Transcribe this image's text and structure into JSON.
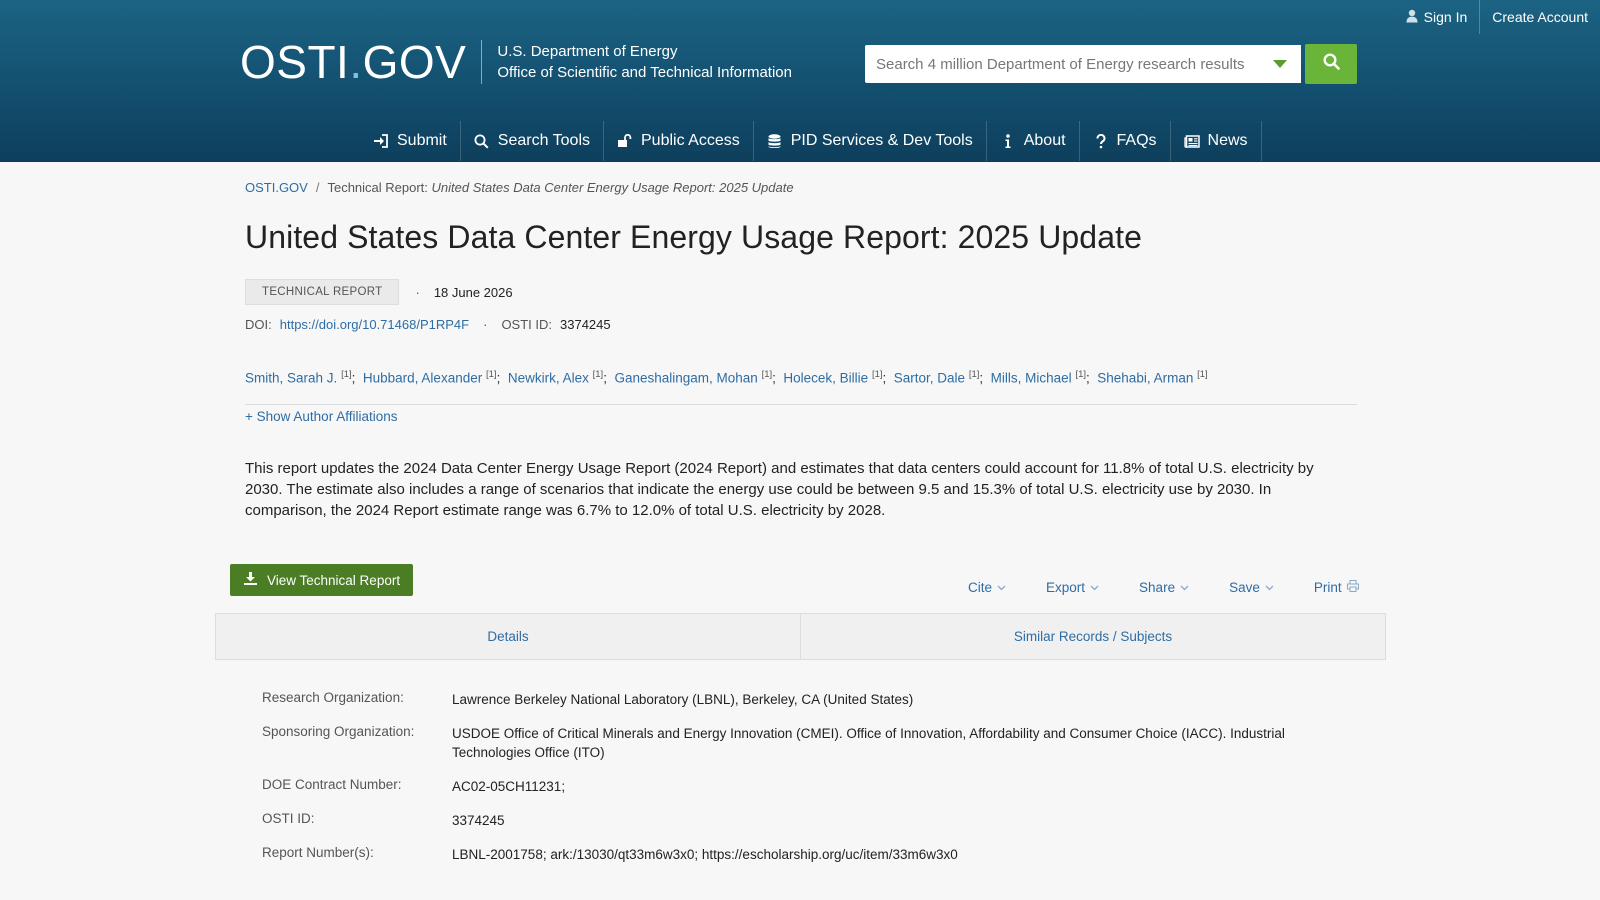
{
  "topbar": {
    "sign_in": "Sign In",
    "create_account": "Create Account"
  },
  "logo": {
    "main_left": "OSTI",
    "dot": ".",
    "main_right": "GOV",
    "line1": "U.S. Department of Energy",
    "line2": "Office of Scientific and Technical Information"
  },
  "search": {
    "placeholder": "Search 4 million Department of Energy research results"
  },
  "nav": {
    "submit": "Submit",
    "search_tools": "Search Tools",
    "public_access": "Public Access",
    "pid_services": "PID Services & Dev Tools",
    "about": "About",
    "faqs": "FAQs",
    "news": "News"
  },
  "breadcrumb": {
    "home": "OSTI.GOV",
    "sep": "/",
    "prefix": "Technical Report: ",
    "current": "United States Data Center Energy Usage Report: 2025 Update"
  },
  "record": {
    "title": "United States Data Center Energy Usage Report: 2025 Update",
    "type_badge": "TECHNICAL REPORT",
    "bullet": "·",
    "date": "18 June 2026",
    "doi_label": "DOI:",
    "doi_value": "https://doi.org/10.71468/P1RP4F",
    "osti_id_label": "OSTI ID:",
    "osti_id_value": "3374245",
    "show_affiliations": "+ Show Author Affiliations",
    "abstract": "This report updates the 2024 Data Center Energy Usage Report (2024 Report) and estimates that data centers could account for 11.8% of total U.S. electricity by 2030. The estimate also includes a range of scenarios that indicate the energy use could be between 9.5 and 15.3% of total U.S. electricity use by 2030. In comparison, the 2024 Report estimate range was 6.7% to 12.0% of total U.S. electricity by 2028."
  },
  "authors": [
    {
      "name": "Smith, Sarah J.",
      "aff": "[1]"
    },
    {
      "name": "Hubbard, Alexander",
      "aff": "[1]"
    },
    {
      "name": "Newkirk, Alex",
      "aff": "[1]"
    },
    {
      "name": "Ganeshalingam, Mohan",
      "aff": "[1]"
    },
    {
      "name": "Holecek, Billie",
      "aff": "[1]"
    },
    {
      "name": "Sartor, Dale",
      "aff": "[1]"
    },
    {
      "name": "Mills, Michael",
      "aff": "[1]"
    },
    {
      "name": "Shehabi, Arman",
      "aff": "[1]"
    }
  ],
  "actions": {
    "view_report": "View Technical Report",
    "cite": "Cite",
    "export": "Export",
    "share": "Share",
    "save": "Save",
    "print": "Print"
  },
  "tabs": {
    "details": "Details",
    "similar": "Similar Records / Subjects"
  },
  "details": [
    {
      "label": "Research Organization:",
      "value": "Lawrence Berkeley National Laboratory (LBNL), Berkeley, CA (United States)"
    },
    {
      "label": "Sponsoring Organization:",
      "value": "USDOE Office of Critical Minerals and Energy Innovation (CMEI). Office of Innovation, Affordability and Consumer Choice (IACC). Industrial Technologies Office (ITO)"
    },
    {
      "label": "DOE Contract Number:",
      "value": "AC02-05CH11231;"
    },
    {
      "label": "OSTI ID:",
      "value": "3374245"
    },
    {
      "label": "Report Number(s):",
      "value": "LBNL-2001758; ark:/13030/qt33m6w3x0; https://escholarship.org/uc/item/33m6w3x0"
    }
  ],
  "colors": {
    "header_top": "#1c6383",
    "header_bottom": "#0d3f5c",
    "search_green": "#6bb43a",
    "view_green": "#4b7d24",
    "link": "#2e6da4"
  }
}
